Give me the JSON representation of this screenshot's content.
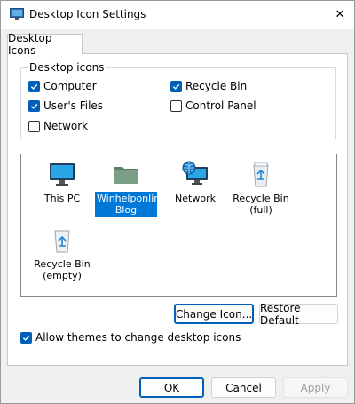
{
  "window": {
    "title": "Desktop Icon Settings",
    "close_glyph": "✕"
  },
  "tabs": [
    {
      "label": "Desktop Icons",
      "selected": true
    }
  ],
  "desktop_icons_group": {
    "legend": "Desktop icons",
    "options": [
      {
        "label": "Computer",
        "checked": true
      },
      {
        "label": "Recycle Bin",
        "checked": true
      },
      {
        "label": "User's Files",
        "checked": true
      },
      {
        "label": "Control Panel",
        "checked": false
      },
      {
        "label": "Network",
        "checked": false
      }
    ]
  },
  "icon_list": {
    "items": [
      {
        "label": "This PC",
        "icon": "monitor-icon",
        "selected": false
      },
      {
        "label": "Winhelponline Blog",
        "icon": "folder-icon",
        "selected": true
      },
      {
        "label": "Network",
        "icon": "network-globe-icon",
        "selected": false
      },
      {
        "label": "Recycle Bin (full)",
        "icon": "recycle-bin-full-icon",
        "selected": false
      },
      {
        "label": "Recycle Bin (empty)",
        "icon": "recycle-bin-empty-icon",
        "selected": false
      }
    ]
  },
  "buttons": {
    "change_icon": "Change Icon...",
    "restore_default": "Restore Default",
    "ok": "OK",
    "cancel": "Cancel",
    "apply": "Apply"
  },
  "allow_themes": {
    "label": "Allow themes to change desktop icons",
    "checked": true
  },
  "colors": {
    "accent": "#005fb8",
    "selection": "#0078d7"
  }
}
